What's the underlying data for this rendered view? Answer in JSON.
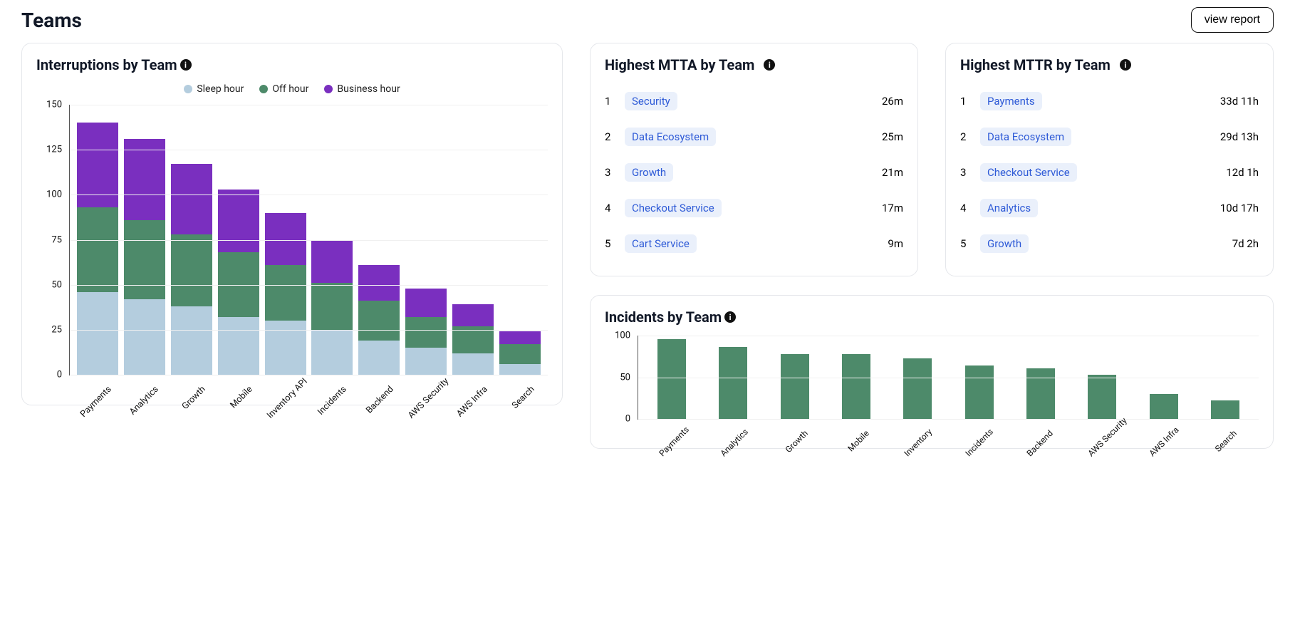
{
  "header": {
    "title": "Teams",
    "view_report": "view report"
  },
  "legend": {
    "sleep": "Sleep hour",
    "off": "Off hour",
    "business": "Business hour"
  },
  "colors": {
    "sleep": "#b4cdde",
    "off": "#4d8a6a",
    "business": "#7a2fbf"
  },
  "titles": {
    "interruptions": "Interruptions by Team",
    "mtta": "Highest MTTA by Team",
    "mttr": "Highest MTTR by Team",
    "incidents": "Incidents by Team"
  },
  "chart_data": [
    {
      "id": "interruptions",
      "type": "bar",
      "stacked": true,
      "title": "Interruptions by Team",
      "ylabel": "",
      "ylim": [
        0,
        150
      ],
      "yticks": [
        0,
        25,
        50,
        75,
        100,
        125,
        150
      ],
      "categories": [
        "Payments",
        "Analytics",
        "Growth",
        "Mobile",
        "Inventory API",
        "Incidents",
        "Backend",
        "AWS Security",
        "AWS Infra",
        "Search"
      ],
      "series": [
        {
          "name": "Sleep hour",
          "color": "#b4cdde",
          "values": [
            46,
            42,
            38,
            32,
            30,
            25,
            19,
            15,
            12,
            6
          ]
        },
        {
          "name": "Off hour",
          "color": "#4d8a6a",
          "values": [
            47,
            44,
            40,
            36,
            31,
            26,
            22,
            17,
            15,
            11
          ]
        },
        {
          "name": "Business hour",
          "color": "#7a2fbf",
          "values": [
            47,
            45,
            39,
            35,
            29,
            24,
            20,
            16,
            12,
            7
          ]
        }
      ]
    },
    {
      "id": "incidents",
      "type": "bar",
      "title": "Incidents by Team",
      "ylim": [
        0,
        100
      ],
      "yticks": [
        0,
        50,
        100
      ],
      "categories": [
        "Payments",
        "Analytics",
        "Growth",
        "Mobile",
        "Inventory",
        "Incidents",
        "Backend",
        "AWS Security",
        "AWS Infra",
        "Search"
      ],
      "values": [
        96,
        86,
        78,
        78,
        73,
        64,
        61,
        53,
        30,
        22
      ],
      "color": "#4d8a6a"
    }
  ],
  "mtta": [
    {
      "rank": "1",
      "team": "Security",
      "value": "26m"
    },
    {
      "rank": "2",
      "team": "Data Ecosystem",
      "value": "25m"
    },
    {
      "rank": "3",
      "team": "Growth",
      "value": "21m"
    },
    {
      "rank": "4",
      "team": "Checkout Service",
      "value": "17m"
    },
    {
      "rank": "5",
      "team": "Cart Service",
      "value": "9m"
    }
  ],
  "mttr": [
    {
      "rank": "1",
      "team": "Payments",
      "value": "33d 11h"
    },
    {
      "rank": "2",
      "team": "Data Ecosystem",
      "value": "29d 13h"
    },
    {
      "rank": "3",
      "team": "Checkout Service",
      "value": "12d 1h"
    },
    {
      "rank": "4",
      "team": "Analytics",
      "value": "10d 17h"
    },
    {
      "rank": "5",
      "team": "Growth",
      "value": "7d 2h"
    }
  ]
}
